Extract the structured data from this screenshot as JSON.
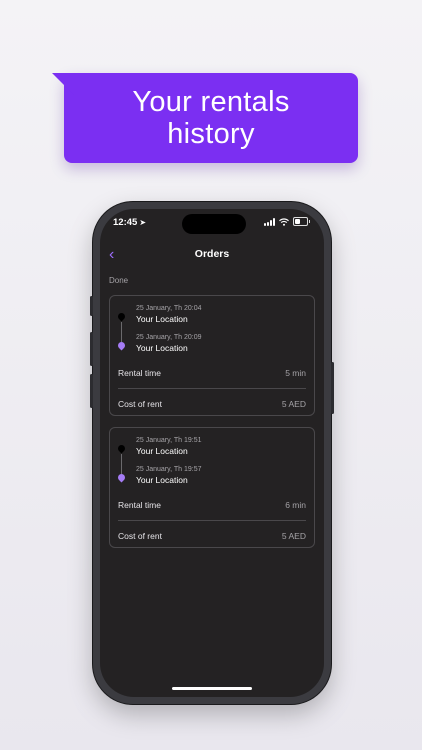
{
  "banner": {
    "line1": "Your rentals",
    "line2": "history"
  },
  "status": {
    "time": "12:45"
  },
  "nav": {
    "title": "Orders"
  },
  "section": {
    "label": "Done"
  },
  "orders": [
    {
      "start_time": "25 January, Th 20:04",
      "start_place": "Your Location",
      "end_time": "25 January, Th 20:09",
      "end_place": "Your Location",
      "rental_label": "Rental time",
      "rental_value": "5 min",
      "cost_label": "Cost of rent",
      "cost_value": "5 AED"
    },
    {
      "start_time": "25 January, Th 19:51",
      "start_place": "Your Location",
      "end_time": "25 January, Th 19:57",
      "end_place": "Your Location",
      "rental_label": "Rental time",
      "rental_value": "6 min",
      "cost_label": "Cost of rent",
      "cost_value": "5 AED"
    }
  ],
  "colors": {
    "accent": "#7b2ff2",
    "screen_bg": "#242223",
    "pin_end": "#a57cf5"
  },
  "icons": [
    "back-chevron-icon",
    "location-arrow-icon",
    "signal-icon",
    "wifi-icon",
    "battery-icon",
    "map-pin-icon"
  ]
}
